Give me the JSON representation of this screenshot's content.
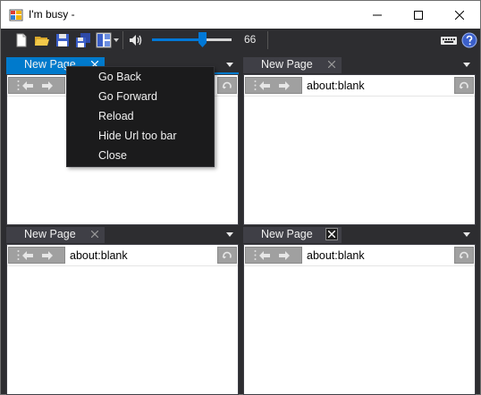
{
  "window": {
    "title": "I'm busy -"
  },
  "toolbar": {
    "volume_value": "66",
    "volume_fraction": 0.64,
    "accent": "#0078d7"
  },
  "icons": {
    "new": "new-file-icon",
    "open": "open-folder-icon",
    "save": "save-disk-icon",
    "save_all": "save-all-icon",
    "layout": "layout-grid-icon",
    "volume": "speaker-icon",
    "keyboard": "keyboard-icon",
    "help": "help-icon"
  },
  "panes": [
    {
      "tab_label": "New Page",
      "url": "",
      "active": true
    },
    {
      "tab_label": "New Page",
      "url": "about:blank",
      "active": false
    },
    {
      "tab_label": "New Page",
      "url": "about:blank",
      "active": false
    },
    {
      "tab_label": "New Page",
      "url": "about:blank",
      "active": false
    }
  ],
  "context_menu": {
    "items": [
      "Go Back",
      "Go Forward",
      "Reload",
      "Hide Url too bar",
      "Close"
    ]
  },
  "colors": {
    "tab_active": "#007acc",
    "tab_inactive": "#3f3f46",
    "background": "#2d2d30",
    "menu_bg": "#1b1b1c"
  }
}
